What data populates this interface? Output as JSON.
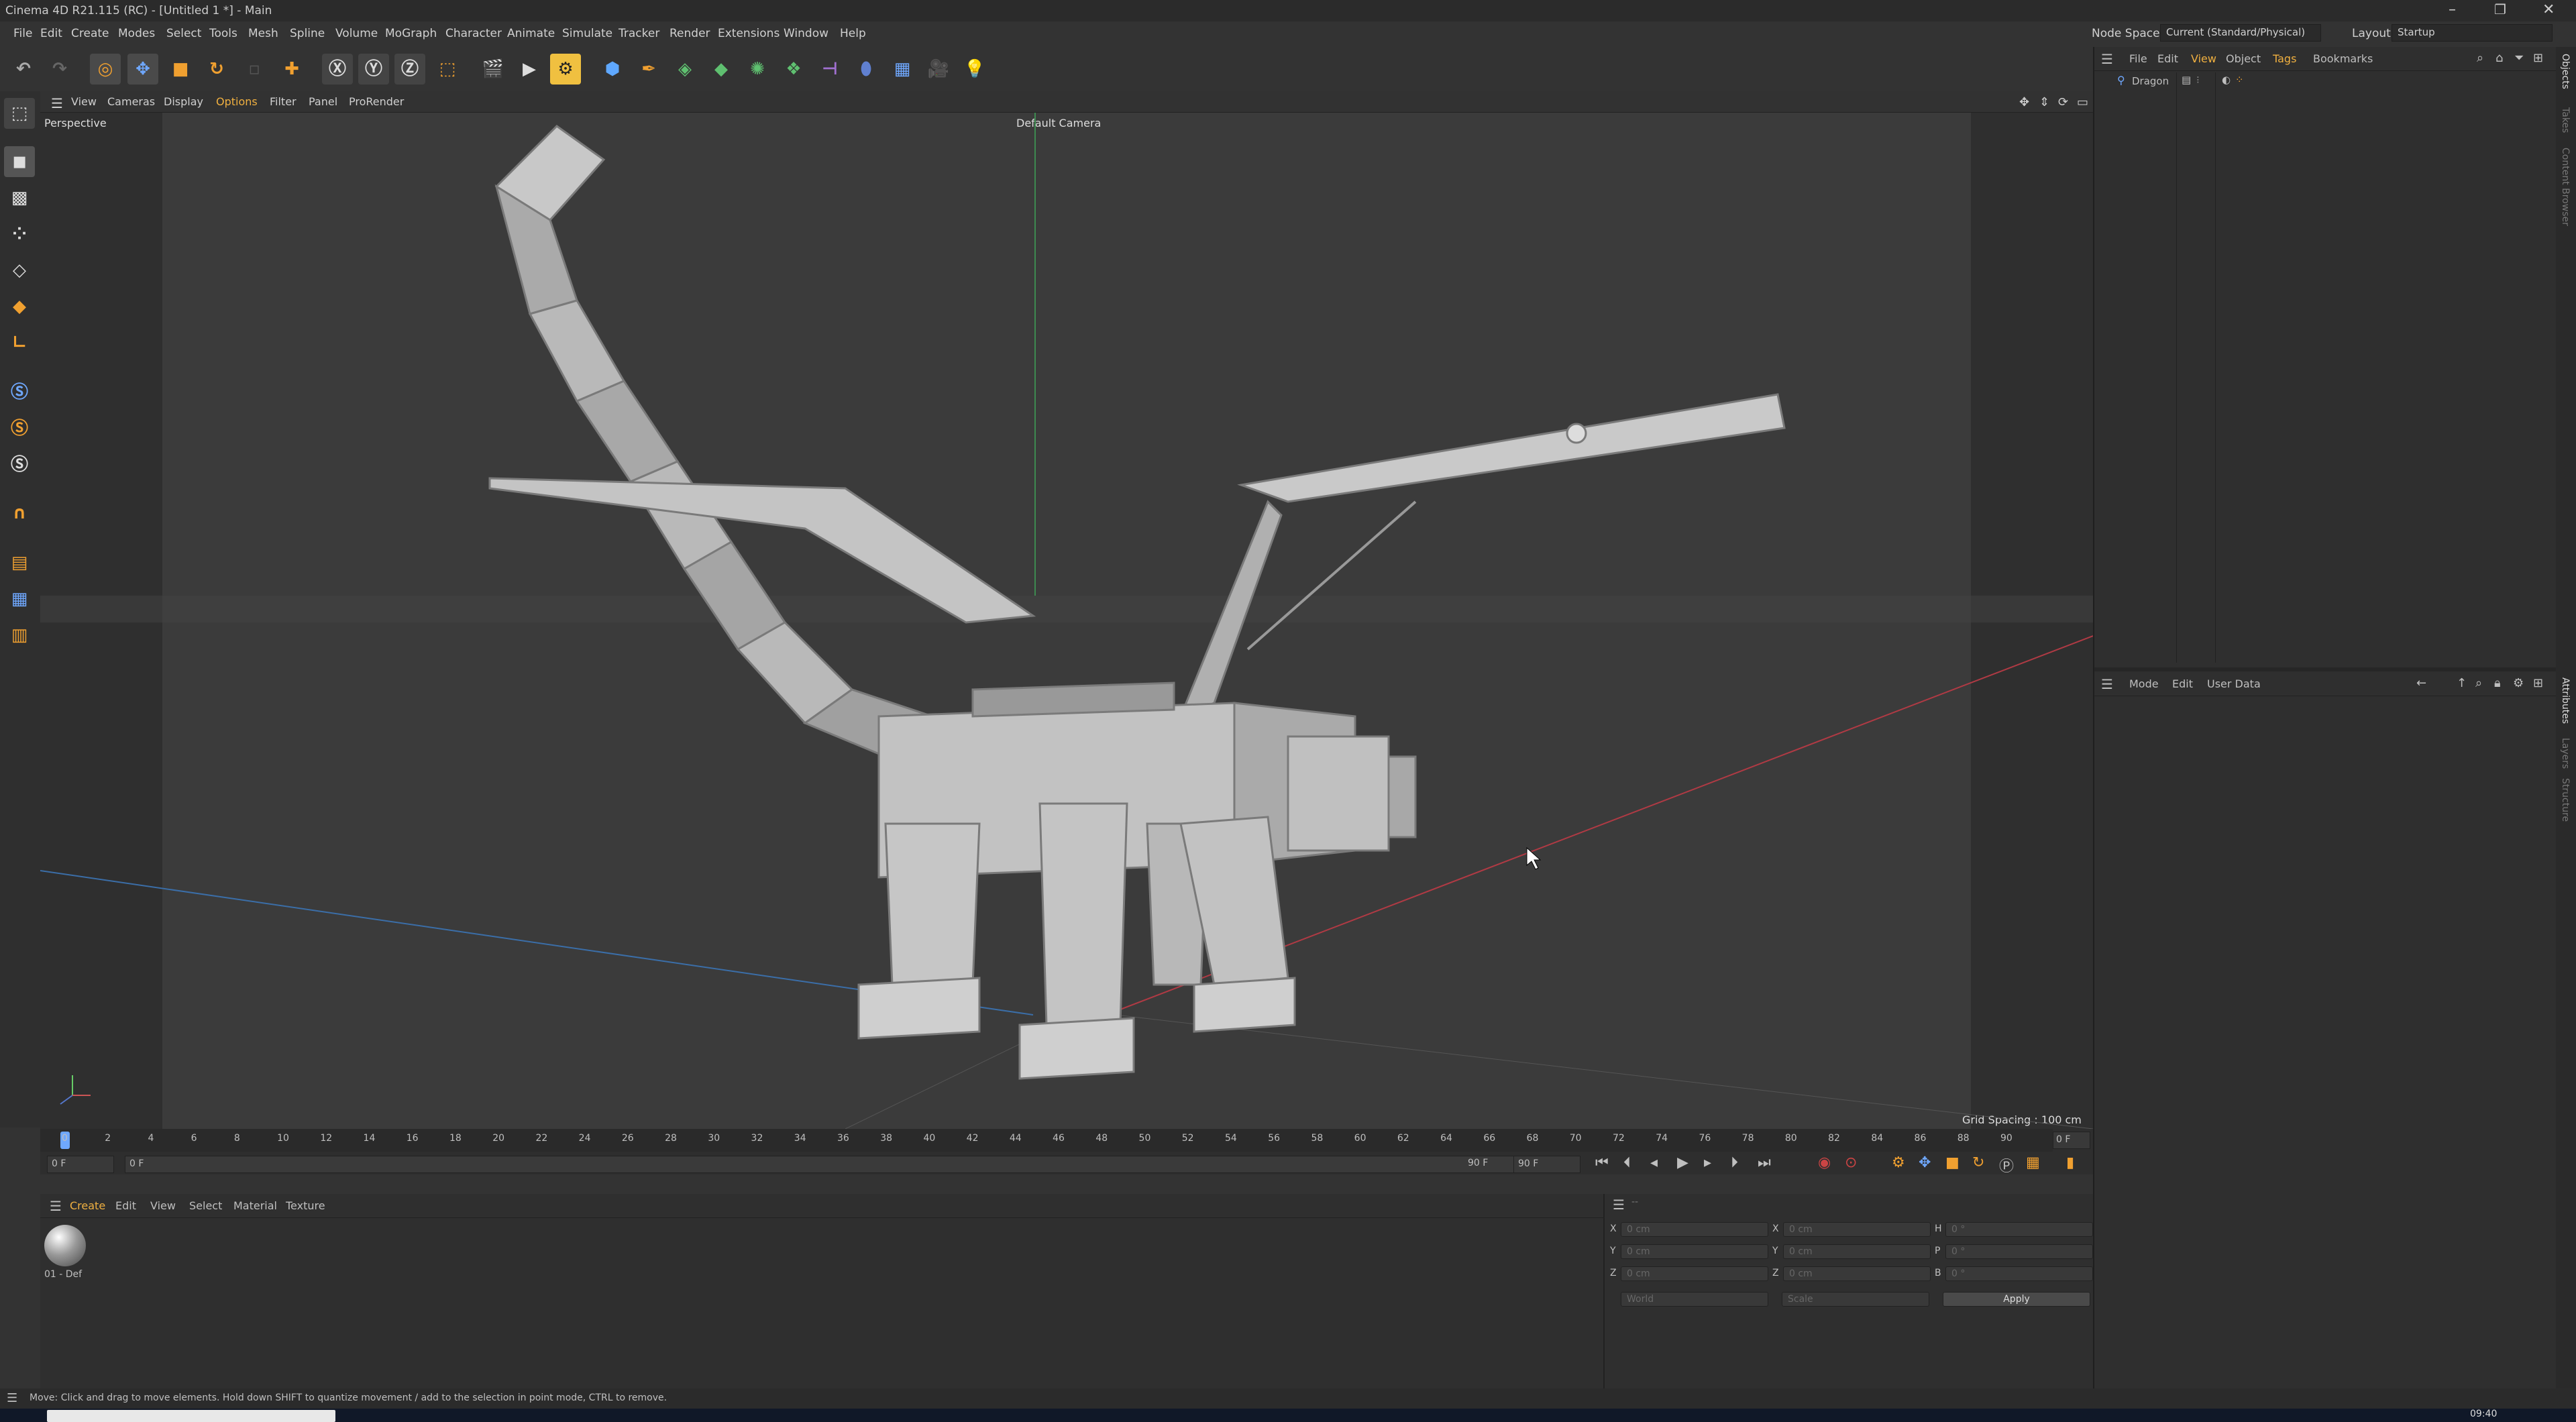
{
  "window": {
    "title": "Cinema 4D R21.115 (RC) - [Untitled 1 *] - Main"
  },
  "menu": [
    "File",
    "Edit",
    "Create",
    "Modes",
    "Select",
    "Tools",
    "Mesh",
    "Spline",
    "Volume",
    "MoGraph",
    "Character",
    "Animate",
    "Simulate",
    "Tracker",
    "Render",
    "Extensions",
    "Window",
    "Help"
  ],
  "node_space": {
    "label": "Node Space:",
    "value": "Current (Standard/Physical)"
  },
  "layout": {
    "label": "Layout:",
    "value": "Startup"
  },
  "viewport": {
    "menu": [
      "View",
      "Cameras",
      "Display",
      "Options",
      "Filter",
      "Panel",
      "ProRender"
    ],
    "name": "Perspective",
    "camera": "Default Camera",
    "grid_spacing": "Grid Spacing : 100 cm"
  },
  "timeline": {
    "ticks": [
      "0",
      "2",
      "4",
      "6",
      "8",
      "10",
      "12",
      "14",
      "16",
      "18",
      "20",
      "22",
      "24",
      "26",
      "28",
      "30",
      "32",
      "34",
      "36",
      "38",
      "40",
      "42",
      "44",
      "46",
      "48",
      "50",
      "52",
      "54",
      "56",
      "58",
      "60",
      "62",
      "64",
      "66",
      "68",
      "70",
      "72",
      "74",
      "76",
      "78",
      "80",
      "82",
      "84",
      "86",
      "88",
      "90"
    ],
    "current_frame": "0 F",
    "start": "0 F",
    "range_start": "0 F",
    "range_end": "90 F",
    "end": "90 F"
  },
  "material_panel": {
    "menu": [
      "Create",
      "Edit",
      "View",
      "Select",
      "Material",
      "Texture"
    ],
    "material_label": "01 - Def"
  },
  "coordinates": {
    "header": "--",
    "rows": [
      {
        "axis": "X",
        "pos": "0 cm",
        "size_axis": "X",
        "size": "0 cm",
        "rot_axis": "H",
        "rot": "0 °"
      },
      {
        "axis": "Y",
        "pos": "0 cm",
        "size_axis": "Y",
        "size": "0 cm",
        "rot_axis": "P",
        "rot": "0 °"
      },
      {
        "axis": "Z",
        "pos": "0 cm",
        "size_axis": "Z",
        "size": "0 cm",
        "rot_axis": "B",
        "rot": "0 °"
      }
    ],
    "space": "World",
    "mode": "Scale",
    "apply": "Apply"
  },
  "object_manager": {
    "menu": [
      "File",
      "Edit",
      "View",
      "Object",
      "Tags",
      "Bookmarks"
    ],
    "object": "Dragon"
  },
  "attributes": {
    "menu": [
      "Mode",
      "Edit",
      "User Data"
    ]
  },
  "side_tabs": [
    "Objects",
    "Takes",
    "Content Browser",
    "Attributes",
    "Layers",
    "Structure"
  ],
  "status": "Move: Click and drag to move elements. Hold down SHIFT to quantize movement / add to the selection in point mode, CTRL to remove.",
  "clock": "09:40",
  "colors": {
    "accent": "#f0a030",
    "panel": "#2f2f2f",
    "viewport": "#3b3b3b",
    "x_axis": "#c0404a",
    "z_axis": "#3b6ea8"
  }
}
